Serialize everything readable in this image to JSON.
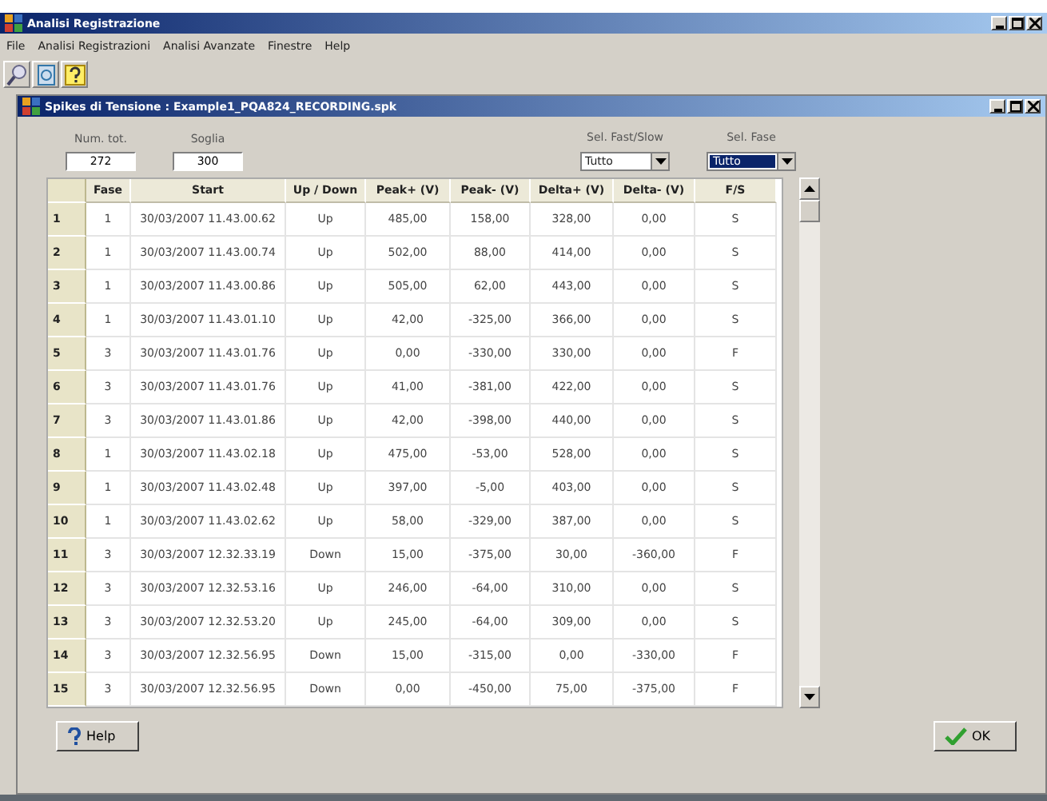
{
  "window": {
    "title": "Analisi Registrazione"
  },
  "menu": [
    "File",
    "Analisi Registrazioni",
    "Analisi Avanzate",
    "Finestre",
    "Help"
  ],
  "child_window": {
    "title": "Spikes di Tensione : Example1_PQA824_RECORDING.spk"
  },
  "fields": [
    {
      "label": "Num. tot.",
      "value": "272"
    },
    {
      "label": "Soglia",
      "value": "300"
    }
  ],
  "dropdowns": [
    {
      "label": "Sel. Fast/Slow",
      "value": "Tutto",
      "highlighted": false
    },
    {
      "label": "Sel. Fase",
      "value": "Tutto",
      "highlighted": true
    }
  ],
  "table": {
    "columns": [
      "Fase",
      "Start",
      "Up / Down",
      "Peak+ (V)",
      "Peak- (V)",
      "Delta+ (V)",
      "Delta- (V)",
      "F/S"
    ],
    "rows": [
      {
        "index": "1",
        "cells": [
          "1",
          "30/03/2007 11.43.00.62",
          "Up",
          "485,00",
          "158,00",
          "328,00",
          "0,00",
          "S"
        ]
      },
      {
        "index": "2",
        "cells": [
          "1",
          "30/03/2007 11.43.00.74",
          "Up",
          "502,00",
          "88,00",
          "414,00",
          "0,00",
          "S"
        ]
      },
      {
        "index": "3",
        "cells": [
          "1",
          "30/03/2007 11.43.00.86",
          "Up",
          "505,00",
          "62,00",
          "443,00",
          "0,00",
          "S"
        ]
      },
      {
        "index": "4",
        "cells": [
          "1",
          "30/03/2007 11.43.01.10",
          "Up",
          "42,00",
          "-325,00",
          "366,00",
          "0,00",
          "S"
        ]
      },
      {
        "index": "5",
        "cells": [
          "3",
          "30/03/2007 11.43.01.76",
          "Up",
          "0,00",
          "-330,00",
          "330,00",
          "0,00",
          "F"
        ]
      },
      {
        "index": "6",
        "cells": [
          "3",
          "30/03/2007 11.43.01.76",
          "Up",
          "41,00",
          "-381,00",
          "422,00",
          "0,00",
          "S"
        ]
      },
      {
        "index": "7",
        "cells": [
          "3",
          "30/03/2007 11.43.01.86",
          "Up",
          "42,00",
          "-398,00",
          "440,00",
          "0,00",
          "S"
        ]
      },
      {
        "index": "8",
        "cells": [
          "1",
          "30/03/2007 11.43.02.18",
          "Up",
          "475,00",
          "-53,00",
          "528,00",
          "0,00",
          "S"
        ]
      },
      {
        "index": "9",
        "cells": [
          "1",
          "30/03/2007 11.43.02.48",
          "Up",
          "397,00",
          "-5,00",
          "403,00",
          "0,00",
          "S"
        ]
      },
      {
        "index": "10",
        "cells": [
          "1",
          "30/03/2007 11.43.02.62",
          "Up",
          "58,00",
          "-329,00",
          "387,00",
          "0,00",
          "S"
        ]
      },
      {
        "index": "11",
        "cells": [
          "3",
          "30/03/2007 12.32.33.19",
          "Down",
          "15,00",
          "-375,00",
          "30,00",
          "-360,00",
          "F"
        ]
      },
      {
        "index": "12",
        "cells": [
          "3",
          "30/03/2007 12.32.53.16",
          "Up",
          "246,00",
          "-64,00",
          "310,00",
          "0,00",
          "S"
        ]
      },
      {
        "index": "13",
        "cells": [
          "3",
          "30/03/2007 12.32.53.20",
          "Up",
          "245,00",
          "-64,00",
          "309,00",
          "0,00",
          "S"
        ]
      },
      {
        "index": "14",
        "cells": [
          "3",
          "30/03/2007 12.32.56.95",
          "Down",
          "15,00",
          "-315,00",
          "0,00",
          "-330,00",
          "F"
        ]
      },
      {
        "index": "15",
        "cells": [
          "3",
          "30/03/2007 12.32.56.95",
          "Down",
          "0,00",
          "-450,00",
          "75,00",
          "-375,00",
          "F"
        ]
      }
    ]
  },
  "buttons": [
    {
      "kind": "help",
      "label": "Help"
    },
    {
      "kind": "ok",
      "label": "OK"
    }
  ]
}
